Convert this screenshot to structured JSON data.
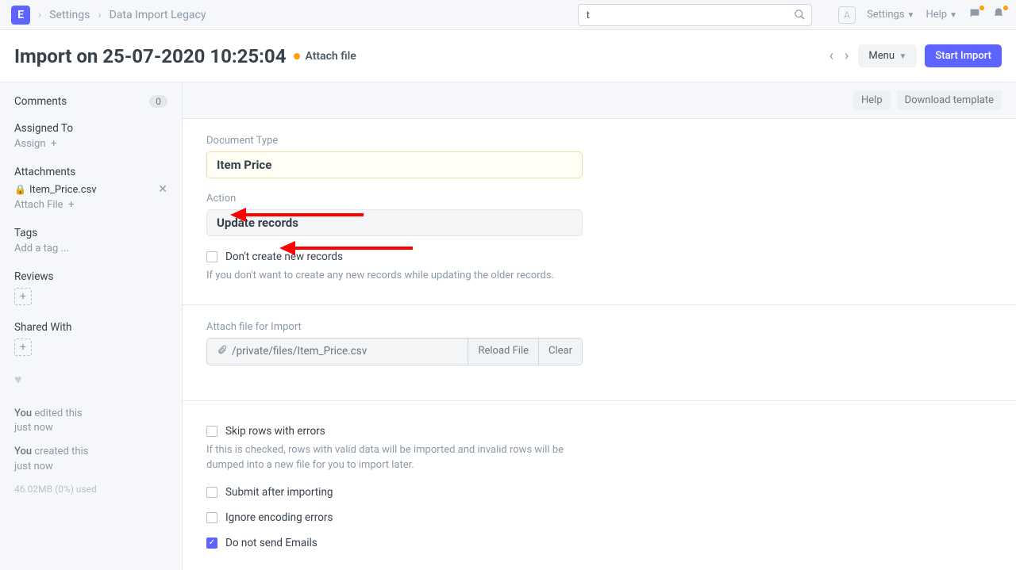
{
  "navbar": {
    "logo": "E",
    "breadcrumbs": [
      "Settings",
      "Data Import Legacy"
    ],
    "search_value": "t",
    "avatar": "A",
    "settings": "Settings",
    "help": "Help"
  },
  "page": {
    "title": "Import on 25-07-2020 10:25:04",
    "attach": "Attach file",
    "menu": "Menu",
    "start_import": "Start Import"
  },
  "sidebar": {
    "comments": "Comments",
    "comments_count": "0",
    "assigned_to": "Assigned To",
    "assign": "Assign",
    "attachments": "Attachments",
    "attach_item": "Item_Price.csv",
    "attach_file": "Attach File",
    "tags": "Tags",
    "add_tag": "Add a tag ...",
    "reviews": "Reviews",
    "shared_with": "Shared With",
    "timeline": [
      {
        "who": "You",
        "what": "edited this",
        "when": "just now"
      },
      {
        "who": "You",
        "what": "created this",
        "when": "just now"
      }
    ],
    "storage": "46.02MB (0%) used"
  },
  "toolbar": {
    "help": "Help",
    "download": "Download template"
  },
  "form": {
    "doctype_label": "Document Type",
    "doctype_value": "Item Price",
    "action_label": "Action",
    "action_value": "Update records",
    "no_create_label": "Don't create new records",
    "no_create_help": "If you don't want to create any new records while updating the older records.",
    "attach_label": "Attach file for Import",
    "file_path": "/private/files/Item_Price.csv",
    "reload": "Reload File",
    "clear": "Clear",
    "skip_label": "Skip rows with errors",
    "skip_help": "If this is checked, rows with valid data will be imported and invalid rows will be dumped into a new file for you to import later.",
    "submit_label": "Submit after importing",
    "ignore_label": "Ignore encoding errors",
    "noemail_label": "Do not send Emails"
  }
}
